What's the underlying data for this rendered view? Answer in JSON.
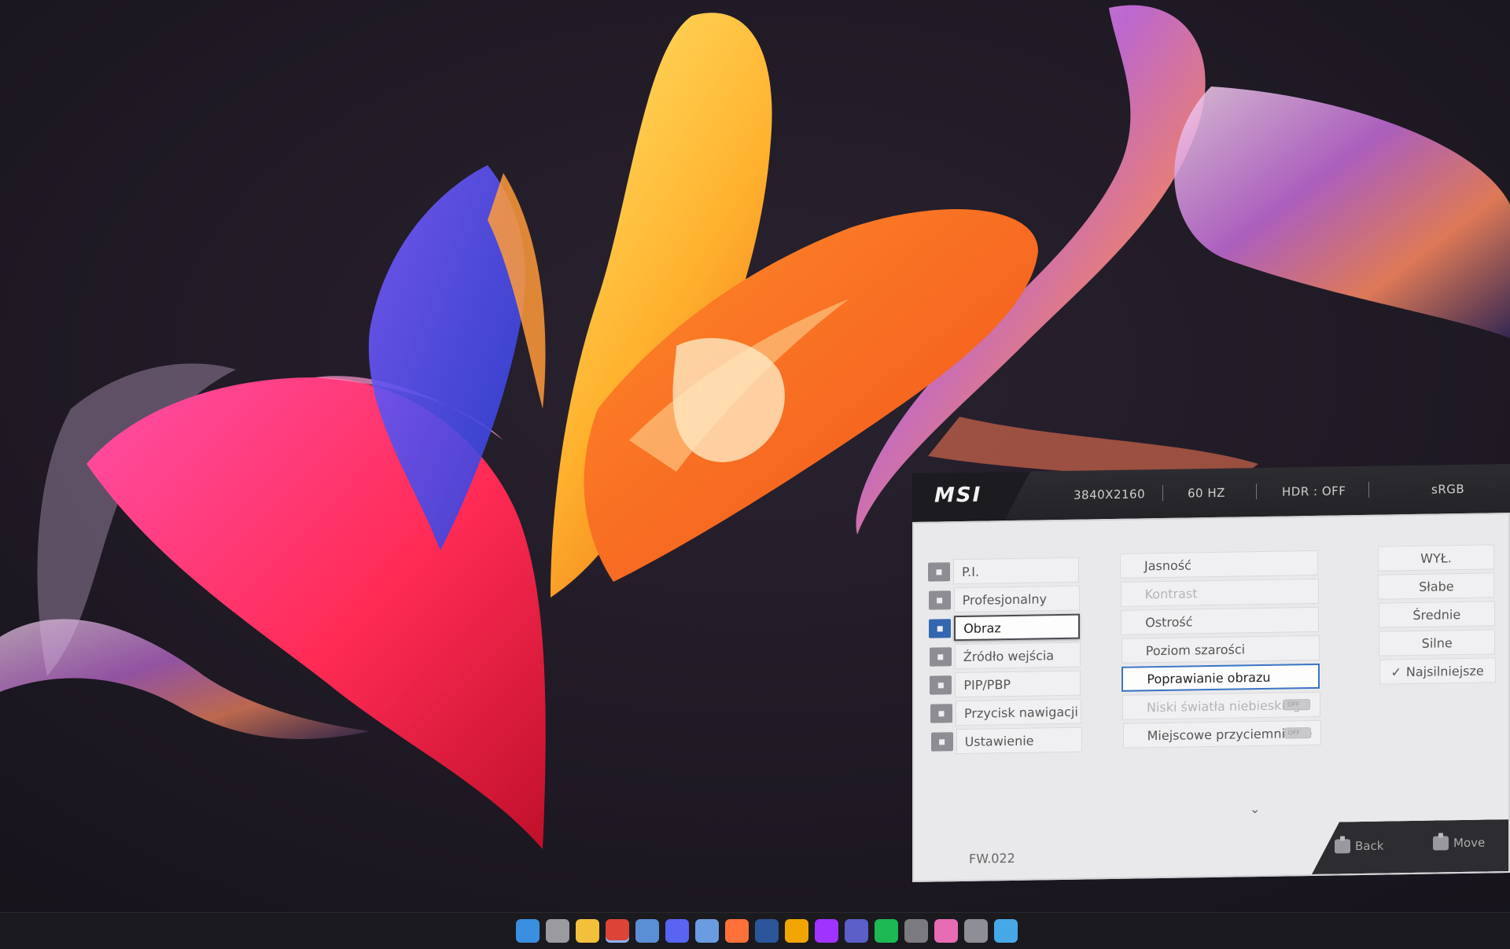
{
  "osd": {
    "brand": "MSI",
    "status": {
      "resolution": "3840X2160",
      "refresh": "60 HZ",
      "hdr": "HDR : OFF",
      "color_mode": "sRGB"
    },
    "menu": [
      {
        "label": "P.I.",
        "icon": "gamepad-icon"
      },
      {
        "label": "Profesjonalny",
        "icon": "flag-icon"
      },
      {
        "label": "Obraz",
        "icon": "image-icon",
        "selected": true
      },
      {
        "label": "Źródło wejścia",
        "icon": "input-arrow-icon"
      },
      {
        "label": "PIP/PBP",
        "icon": "pip-icon"
      },
      {
        "label": "Przycisk nawigacji",
        "icon": "navigation-icon"
      },
      {
        "label": "Ustawienie",
        "icon": "settings-sliders-icon"
      }
    ],
    "submenu": [
      {
        "label": "Jasność"
      },
      {
        "label": "Kontrast",
        "dim": true
      },
      {
        "label": "Ostrość"
      },
      {
        "label": "Poziom szarości"
      },
      {
        "label": "Poprawianie obrazu",
        "focus": true
      },
      {
        "label": "Niski światła niebieskiego",
        "dim": true,
        "toggle": "OFF"
      },
      {
        "label": "Miejscowe przyciemnianie",
        "toggle": "OFF"
      }
    ],
    "options": [
      {
        "label": "WYŁ."
      },
      {
        "label": "Słabe"
      },
      {
        "label": "Średnie"
      },
      {
        "label": "Silne"
      },
      {
        "label": "Najsilniejsze",
        "checked": true
      }
    ],
    "check_mark": "✓",
    "more_chevron": "⌄",
    "firmware": "FW.022",
    "back_label": "Back",
    "move_label": "Move"
  },
  "taskbar": {
    "icons": [
      {
        "name": "windows-start-icon",
        "color": "#3b8fe0"
      },
      {
        "name": "task-view-icon",
        "color": "#9a9aa0"
      },
      {
        "name": "file-explorer-icon",
        "color": "#f2c03a"
      },
      {
        "name": "chrome-icon",
        "color": "#db4437",
        "active": true
      },
      {
        "name": "photos-icon",
        "color": "#5a8fd6"
      },
      {
        "name": "discord-icon",
        "color": "#5865f2"
      },
      {
        "name": "notepad-icon",
        "color": "#6b9be0"
      },
      {
        "name": "firefox-icon",
        "color": "#ff7139"
      },
      {
        "name": "word-icon",
        "color": "#2b579a"
      },
      {
        "name": "edge-icon",
        "color": "#f0a500"
      },
      {
        "name": "messenger-icon",
        "color": "#a033ff"
      },
      {
        "name": "teams-icon",
        "color": "#5b5fc7"
      },
      {
        "name": "spotify-icon",
        "color": "#1db954"
      },
      {
        "name": "calculator-icon",
        "color": "#7a7a80"
      },
      {
        "name": "paint-icon",
        "color": "#e86bb5"
      },
      {
        "name": "settings-gear-icon",
        "color": "#8e8e96"
      },
      {
        "name": "notes-icon",
        "color": "#47a8e8"
      }
    ]
  }
}
